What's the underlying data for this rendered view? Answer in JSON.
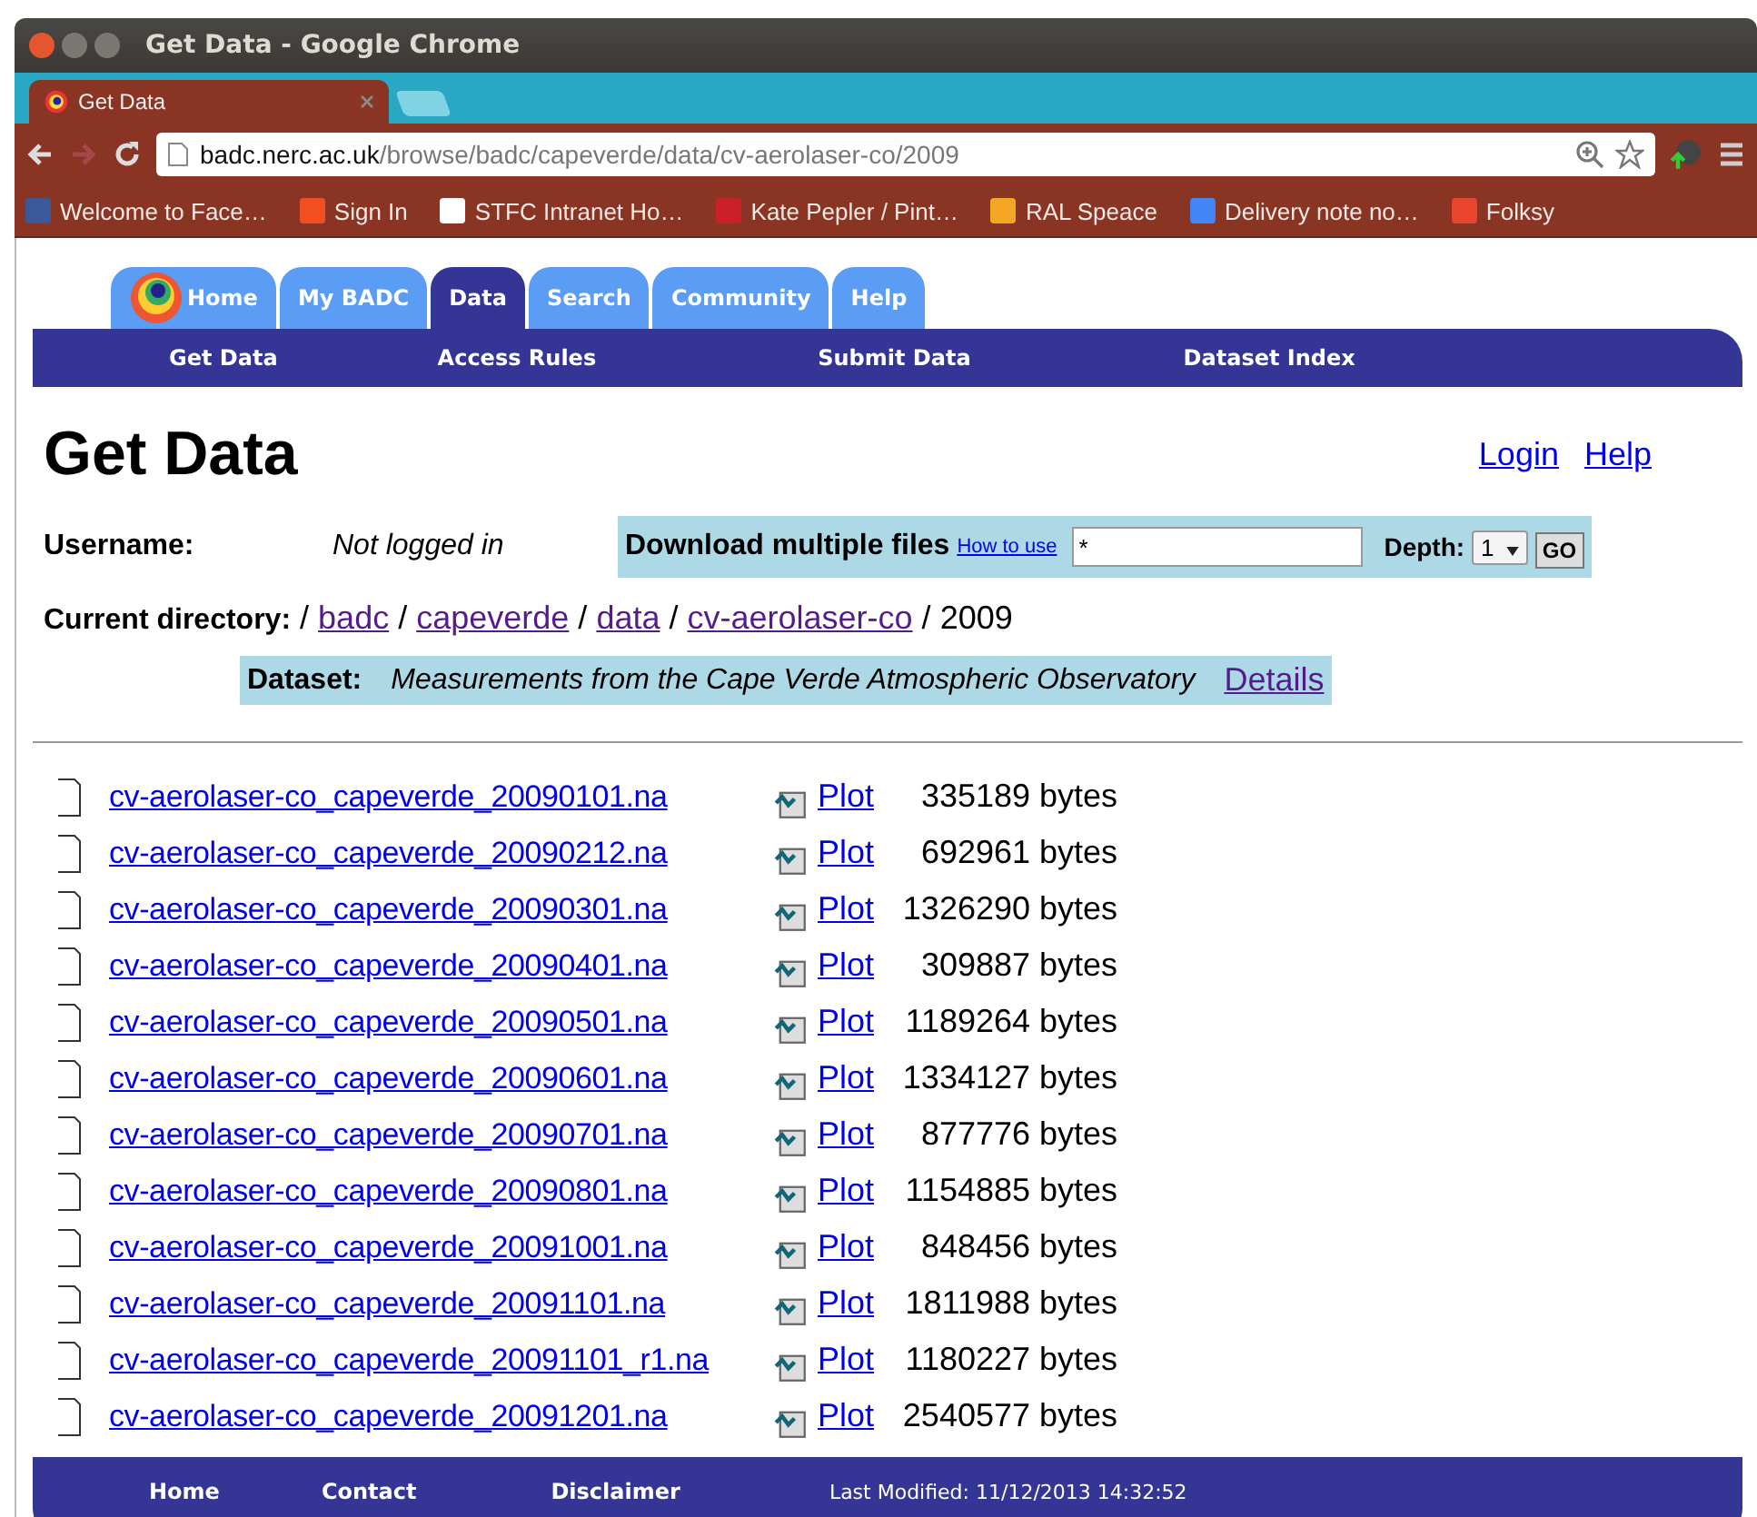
{
  "window": {
    "title": "Get Data - Google Chrome"
  },
  "browser": {
    "tabs": [
      {
        "title": "Get Data",
        "selected": true
      }
    ],
    "address": {
      "host": "badc.nerc.ac.uk",
      "path": "/browse/badc/capeverde/data/cv-aerolaser-co/2009"
    },
    "bookmarks": [
      {
        "label": "Welcome to Face…",
        "color": "#3b5998"
      },
      {
        "label": "Sign In",
        "color": "#f25022"
      },
      {
        "label": "STFC Intranet Ho…",
        "color": "#ffffff"
      },
      {
        "label": "Kate Pepler / Pint…",
        "color": "#cb2027"
      },
      {
        "label": "RAL Speace",
        "color": "#f5a623"
      },
      {
        "label": "Delivery note no…",
        "color": "#4285f4"
      },
      {
        "label": "Folksy",
        "color": "#e8452c"
      }
    ]
  },
  "site": {
    "nav_tabs": [
      {
        "label": "Home",
        "selected": false
      },
      {
        "label": "My BADC",
        "selected": false
      },
      {
        "label": "Data",
        "selected": true
      },
      {
        "label": "Search",
        "selected": false
      },
      {
        "label": "Community",
        "selected": false
      },
      {
        "label": "Help",
        "selected": false
      }
    ],
    "subnav": [
      "Get Data",
      "Access Rules",
      "Submit Data",
      "Dataset Index"
    ]
  },
  "heading": "Get Data",
  "header_links": [
    "Login",
    "Help"
  ],
  "username": {
    "label": "Username:",
    "value": "Not logged in"
  },
  "download": {
    "label": "Download multiple files",
    "how_to_use": "How to use",
    "pattern_value": "*",
    "depth_label": "Depth:",
    "depth_value": "1",
    "go": "GO"
  },
  "current_directory": {
    "label": "Current directory:",
    "parts": [
      {
        "text": "badc",
        "visited": true
      },
      {
        "text": "capeverde",
        "visited": true
      },
      {
        "text": "data",
        "visited": true
      },
      {
        "text": "cv-aerolaser-co",
        "visited": true
      }
    ],
    "current": "2009",
    "separator": "/"
  },
  "dataset": {
    "label": "Dataset:",
    "description": "Measurements from the Cape Verde Atmospheric Observatory",
    "details": "Details",
    "details_visited": true
  },
  "files": [
    {
      "name": "cv-aerolaser-co_capeverde_20090101.na",
      "plot": "Plot",
      "size": "335189 bytes"
    },
    {
      "name": "cv-aerolaser-co_capeverde_20090212.na",
      "plot": "Plot",
      "size": "692961 bytes"
    },
    {
      "name": "cv-aerolaser-co_capeverde_20090301.na",
      "plot": "Plot",
      "size": "1326290 bytes"
    },
    {
      "name": "cv-aerolaser-co_capeverde_20090401.na",
      "plot": "Plot",
      "size": "309887 bytes"
    },
    {
      "name": "cv-aerolaser-co_capeverde_20090501.na",
      "plot": "Plot",
      "size": "1189264 bytes"
    },
    {
      "name": "cv-aerolaser-co_capeverde_20090601.na",
      "plot": "Plot",
      "size": "1334127 bytes"
    },
    {
      "name": "cv-aerolaser-co_capeverde_20090701.na",
      "plot": "Plot",
      "size": "877776 bytes"
    },
    {
      "name": "cv-aerolaser-co_capeverde_20090801.na",
      "plot": "Plot",
      "size": "1154885 bytes"
    },
    {
      "name": "cv-aerolaser-co_capeverde_20091001.na",
      "plot": "Plot",
      "size": "848456 bytes"
    },
    {
      "name": "cv-aerolaser-co_capeverde_20091101.na",
      "plot": "Plot",
      "size": "1811988 bytes"
    },
    {
      "name": "cv-aerolaser-co_capeverde_20091101_r1.na",
      "plot": "Plot",
      "size": "1180227 bytes"
    },
    {
      "name": "cv-aerolaser-co_capeverde_20091201.na",
      "plot": "Plot",
      "size": "2540577 bytes"
    }
  ],
  "footer": {
    "links": [
      "Home",
      "Contact",
      "Disclaimer"
    ],
    "last_modified": "Last Modified: 11/12/2013 14:32:52"
  }
}
